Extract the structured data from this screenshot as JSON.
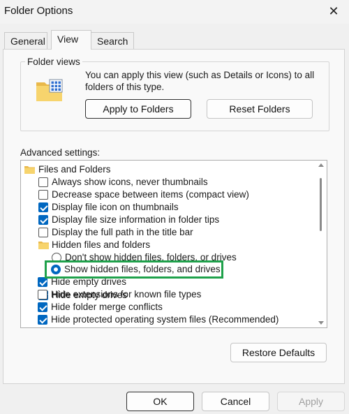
{
  "window": {
    "title": "Folder Options",
    "close_glyph": "✕"
  },
  "tabs": [
    {
      "label": "General"
    },
    {
      "label": "View"
    },
    {
      "label": "Search"
    }
  ],
  "folder_views": {
    "legend": "Folder views",
    "description": "You can apply this view (such as Details or Icons) to all folders of this type.",
    "apply_label": "Apply to Folders",
    "reset_label": "Reset Folders"
  },
  "advanced": {
    "label": "Advanced settings:",
    "items": [
      {
        "type": "folder",
        "label": "Files and Folders"
      },
      {
        "type": "checkbox",
        "label": "Always show icons, never thumbnails",
        "checked": false
      },
      {
        "type": "checkbox",
        "label": "Decrease space between items (compact view)",
        "checked": false
      },
      {
        "type": "checkbox",
        "label": "Display file icon on thumbnails",
        "checked": true
      },
      {
        "type": "checkbox",
        "label": "Display file size information in folder tips",
        "checked": true
      },
      {
        "type": "checkbox",
        "label": "Display the full path in the title bar",
        "checked": false
      },
      {
        "type": "folder",
        "label": "Hidden files and folders"
      },
      {
        "type": "radio",
        "label": "Don't show hidden files, folders, or drives",
        "checked": false
      },
      {
        "type": "radio",
        "label": "Show hidden files, folders, and drives",
        "checked": true
      },
      {
        "type": "checkbox",
        "label": "Hide empty drives",
        "checked": true
      },
      {
        "type": "checkbox",
        "label": "Hide extensions for known file types",
        "checked": false
      },
      {
        "type": "checkbox",
        "label": "Hide folder merge conflicts",
        "checked": true
      },
      {
        "type": "checkbox",
        "label": "Hide protected operating system files (Recommended)",
        "checked": true
      }
    ]
  },
  "restore_defaults_label": "Restore Defaults",
  "footer": {
    "ok_label": "OK",
    "cancel_label": "Cancel",
    "apply_label": "Apply"
  },
  "colors": {
    "accent": "#0067c0",
    "highlight_box": "#1fa14b"
  }
}
